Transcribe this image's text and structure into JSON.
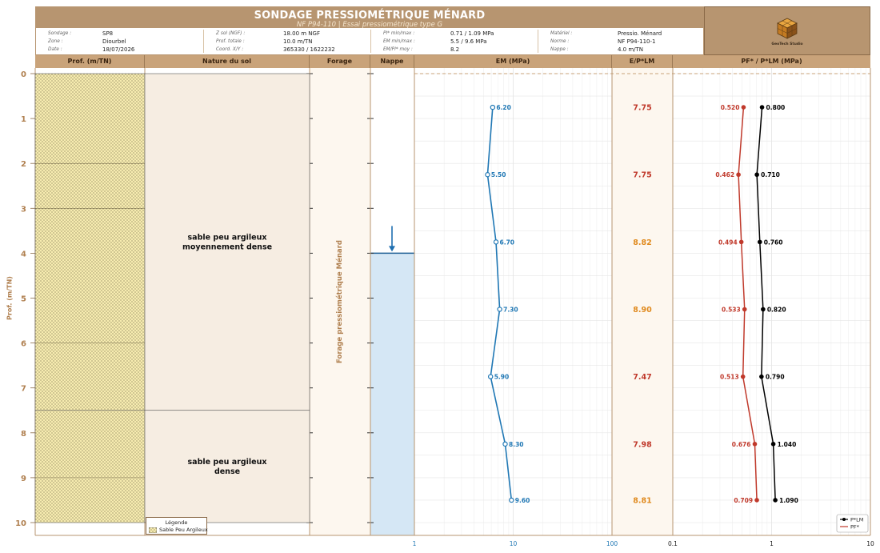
{
  "header": {
    "title": "SONDAGE PRESSIOMÉTRIQUE MÉNARD",
    "subtitle": "NF P94-110  |  Essai pressiométrique type G"
  },
  "info": {
    "col1": [
      {
        "label": "Sondage :",
        "value": "SP8"
      },
      {
        "label": "Zone :",
        "value": "Diourbel"
      },
      {
        "label": "Date :",
        "value": "18/07/2026"
      }
    ],
    "col2": [
      {
        "label": "Z sol (NGF) :",
        "value": "18.00 m NGF"
      },
      {
        "label": "Prof. totale :",
        "value": "10.0 m/TN"
      },
      {
        "label": "Coord. X/Y :",
        "value": "365330 / 1622232"
      }
    ],
    "col3": [
      {
        "label": "Pl* min/max :",
        "value": "0.71 / 1.09 MPa"
      },
      {
        "label": "EM  min/max :",
        "value": "5.5 / 9.6 MPa"
      },
      {
        "label": "EM/Pl* moy :",
        "value": "8.2"
      }
    ],
    "col4": [
      {
        "label": "Matériel :",
        "value": "Pressio. Ménard"
      },
      {
        "label": "Norme :",
        "value": "NF P94-110-1"
      },
      {
        "label": "Nappe :",
        "value": "4.0 m/TN"
      }
    ]
  },
  "logo": {
    "icon": "geotech-cube-logo",
    "caption": "GeoTech Studio"
  },
  "columns": {
    "prof": "Prof. (m/TN)",
    "nature": "Nature du sol",
    "forage": "Forage",
    "nappe": "Nappe",
    "em": "EM (MPa)",
    "ratio": "E/P*LM",
    "pl": "PF* / P*LM (MPa)"
  },
  "depth_axis_label": "Prof. (m/TN)",
  "forage_label": "Forage pressiométrique Ménard",
  "legend": {
    "title": "Légende",
    "item": "Sable Peu Argileux"
  },
  "layers": [
    {
      "from": 0,
      "to": 7.5,
      "lines": [
        "sable peu argileux",
        "moyennement dense"
      ]
    },
    {
      "from": 7.5,
      "to": 10,
      "lines": [
        "sable peu argileux",
        "dense"
      ]
    }
  ],
  "water_table_depth": 4.0,
  "colors": {
    "header": "#b79570",
    "col_header": "#c9a37a",
    "soil_fill": "#f7ecb0",
    "em_line": "#1f77b4",
    "pf_line": "#c0392b",
    "pl_line": "#000000",
    "ratio_red": "#c0392b",
    "ratio_orange": "#e08a1e",
    "water": "#d5e7f5"
  },
  "chart_data": [
    {
      "type": "line",
      "name": "EM profile",
      "x_scale": "log",
      "xlim": [
        1,
        100
      ],
      "x_ticks": [
        "1",
        "10",
        "100"
      ],
      "ylim": [
        10,
        0
      ],
      "y_ticks": [
        "0",
        "1",
        "2",
        "3",
        "4",
        "5",
        "6",
        "7",
        "8",
        "9",
        "10"
      ],
      "ylabel": "Prof. (m/TN)",
      "depths": [
        0.75,
        2.25,
        3.75,
        5.25,
        6.75,
        8.25,
        9.5
      ],
      "values": [
        6.2,
        5.5,
        6.7,
        7.3,
        5.9,
        8.3,
        9.6
      ],
      "labels": [
        "6.20",
        "5.50",
        "6.70",
        "7.30",
        "5.90",
        "8.30",
        "9.60"
      ]
    },
    {
      "type": "table",
      "name": "E/P*LM",
      "depths": [
        0.75,
        2.25,
        3.75,
        5.25,
        6.75,
        8.25,
        9.5
      ],
      "values": [
        "7.75",
        "7.75",
        "8.82",
        "8.90",
        "7.47",
        "7.98",
        "8.81"
      ]
    },
    {
      "type": "line",
      "x_scale": "log",
      "xlim": [
        0.1,
        10
      ],
      "x_ticks": [
        "0.1",
        "1",
        "10"
      ],
      "legend_position": "bottom-right",
      "series": [
        {
          "name": "P*LM",
          "depths": [
            0.75,
            2.25,
            3.75,
            5.25,
            6.75,
            8.25,
            9.5
          ],
          "values": [
            0.8,
            0.71,
            0.76,
            0.82,
            0.79,
            1.04,
            1.09
          ],
          "labels": [
            "0.800",
            "0.710",
            "0.760",
            "0.820",
            "0.790",
            "1.040",
            "1.090"
          ]
        },
        {
          "name": "PF*",
          "depths": [
            0.75,
            2.25,
            3.75,
            5.25,
            6.75,
            8.25,
            9.5
          ],
          "values": [
            0.52,
            0.462,
            0.494,
            0.533,
            0.513,
            0.676,
            0.709
          ],
          "labels": [
            "0.520",
            "0.462",
            "0.494",
            "0.533",
            "0.513",
            "0.676",
            "0.709"
          ]
        }
      ]
    }
  ]
}
